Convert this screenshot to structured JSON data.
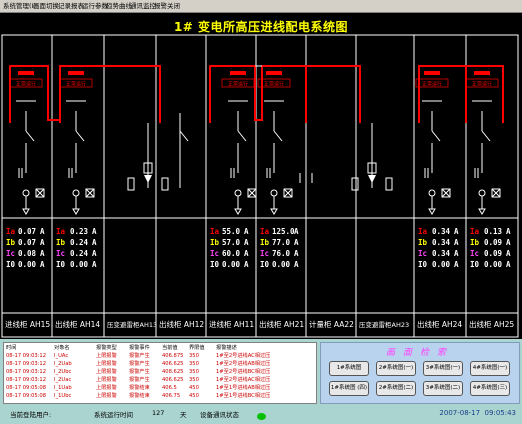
{
  "menu": [
    "系统管理(I)",
    "画面切换",
    "记录报表",
    "运行参数",
    "趋势曲线",
    "通讯监控",
    "报警关闭"
  ],
  "title": "1# 变电所高压进线配电系统图",
  "colors": {
    "bus": "#ff0000",
    "ia": "#ff0000",
    "ib": "#ffff00",
    "ic": "#ff44ff",
    "i0": "#ffffff",
    "frame": "#ffffff"
  },
  "breaker_label": "正常运行",
  "cabinets": [
    {
      "label": "进线柜 AH15",
      "meas": {
        "Ia": "0.07",
        "Ib": "0.07",
        "Ic": "0.08",
        "I0": "0.00"
      }
    },
    {
      "label": "出线柜 AH14",
      "meas": {
        "Ia": "0.23",
        "Ib": "0.24",
        "Ic": "0.24",
        "I0": "0.00"
      }
    },
    {
      "label": "压变避雷柜AH13",
      "meas": null
    },
    {
      "label": "出线柜 AH12",
      "meas": null
    },
    {
      "label": "进线柜 AH11",
      "meas": {
        "Ia": "55.0",
        "Ib": "57.0",
        "Ic": "60.0",
        "I0": "0.00"
      }
    },
    {
      "label": "出线柜 AH21",
      "meas": {
        "Ia": "125.0",
        "Ib": "77.0",
        "Ic": "76.0",
        "I0": "0.00"
      }
    },
    {
      "label": "计量柜 AA22",
      "meas": null
    },
    {
      "label": "压变避雷柜AH23",
      "meas": null
    },
    {
      "label": "出线柜 AH24",
      "meas": {
        "Ia": "0.34",
        "Ib": "0.34",
        "Ic": "0.34",
        "I0": "0.00"
      }
    },
    {
      "label": "出线柜 AH25",
      "meas": {
        "Ia": "0.13",
        "Ib": "0.09",
        "Ic": "0.09",
        "I0": "0.00"
      }
    }
  ],
  "unit": "A",
  "alarm_headers": [
    "时间",
    "对象名",
    "报警类型",
    "报警事件",
    "当前值",
    "界限值",
    "报警描述"
  ],
  "alarms": [
    [
      "08-17 09:03:12",
      "I_UAc",
      "上限报警",
      "报警产生",
      "406.875",
      "350",
      "1#至2号进线AC相过压"
    ],
    [
      "08-17 09:03:12",
      "I_2Uab",
      "上限报警",
      "报警产生",
      "406.625",
      "350",
      "1#至2号进线AB相过压"
    ],
    [
      "08-17 09:03:12",
      "I_2Ubc",
      "上限报警",
      "报警产生",
      "408.625",
      "350",
      "1#至2号进线BC相过压"
    ],
    [
      "08-17 09:03:12",
      "I_2Uac",
      "上限报警",
      "报警产生",
      "406.625",
      "350",
      "1#至2号进线AC相过压"
    ],
    [
      "08-17 09:05:08",
      "I_1Uab",
      "上限报警",
      "报警结束",
      "406.5",
      "450",
      "1#至1号进线AB相过压"
    ],
    [
      "08-17 09:05:08",
      "I_1Ubc",
      "上限报警",
      "报警结束",
      "406.75",
      "450",
      "1#至1号进线BC相过压"
    ]
  ],
  "nav": {
    "title": "画面检索",
    "buttons": [
      "1#系统图",
      "2#系统图(一)",
      "3#系统图(一)",
      "4#系统图(一)",
      "1#系统图 (四)",
      "2#系统图(二)",
      "3#系统图(二)",
      "4#系统图(三)"
    ]
  },
  "status": {
    "user_label": "当前登陆用户:",
    "runtime_label": "系统运行时间",
    "runtime_value": "127",
    "runtime_unit": "天",
    "comm_label": "设备通讯状态",
    "date": "2007-08-17",
    "time": "09:05:43"
  }
}
